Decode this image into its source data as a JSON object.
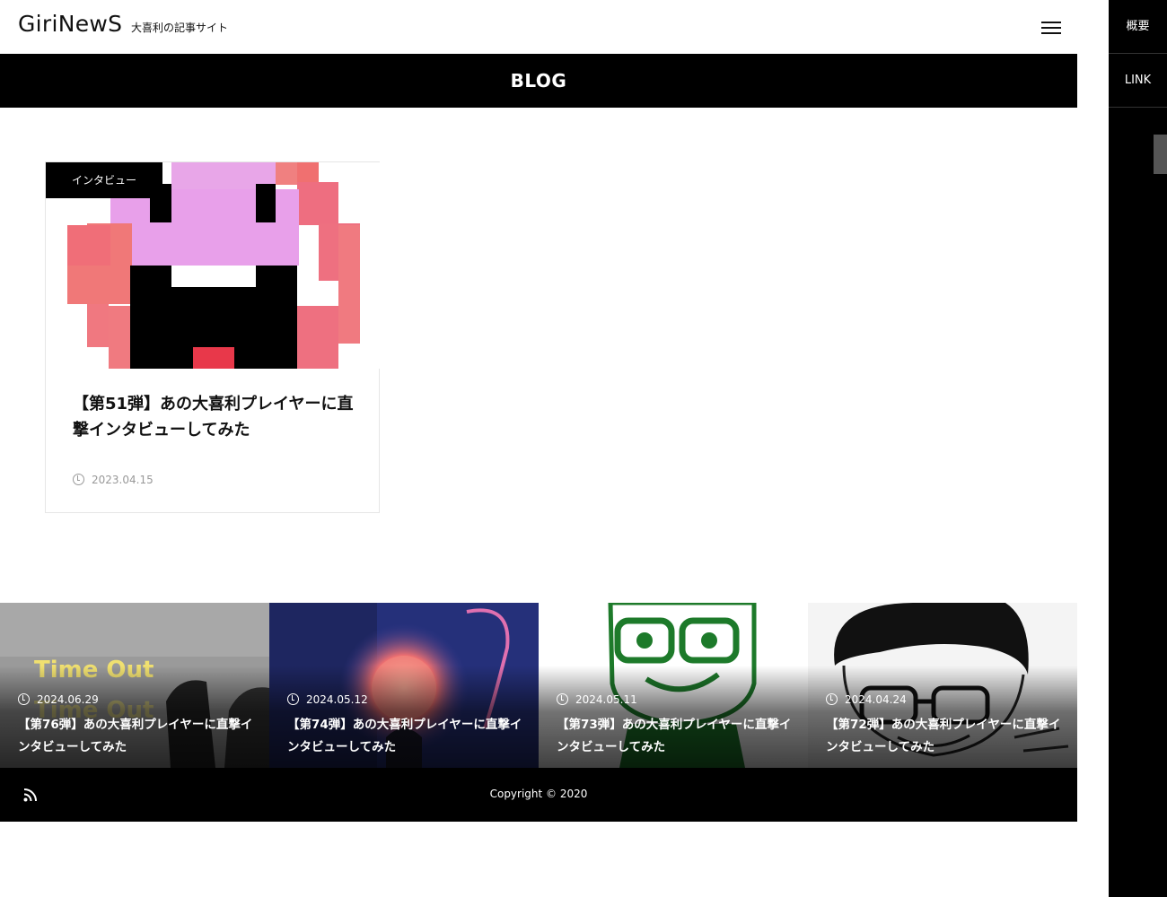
{
  "site": {
    "logo": "GiriNewS",
    "tagline": "大喜利の記事サイト",
    "menu_icon": "hamburger-icon"
  },
  "page": {
    "title": "BLOG"
  },
  "side_menu": {
    "items": [
      {
        "label": "概要"
      },
      {
        "label": "LINK"
      }
    ]
  },
  "article": {
    "category": "インタビュー",
    "title": "【第51弾】あの大喜利プレイヤーに直撃インタビューしてみた",
    "date": "2023.04.15"
  },
  "recent": [
    {
      "date": "2024.06.29",
      "title": "【第76弾】あの大喜利プレイヤーに直撃インタビューしてみた"
    },
    {
      "date": "2024.05.12",
      "title": "【第74弾】あの大喜利プレイヤーに直撃インタビューしてみた"
    },
    {
      "date": "2024.05.11",
      "title": "【第73弾】あの大喜利プレイヤーに直撃インタビューしてみた"
    },
    {
      "date": "2024.04.24",
      "title": "【第72弾】あの大喜利プレイヤーに直撃インタビューしてみた"
    }
  ],
  "footer": {
    "copyright": "Copyright © 2020",
    "feed_icon": "rss-icon"
  },
  "thumb_text": {
    "time_out": "Time Out"
  }
}
